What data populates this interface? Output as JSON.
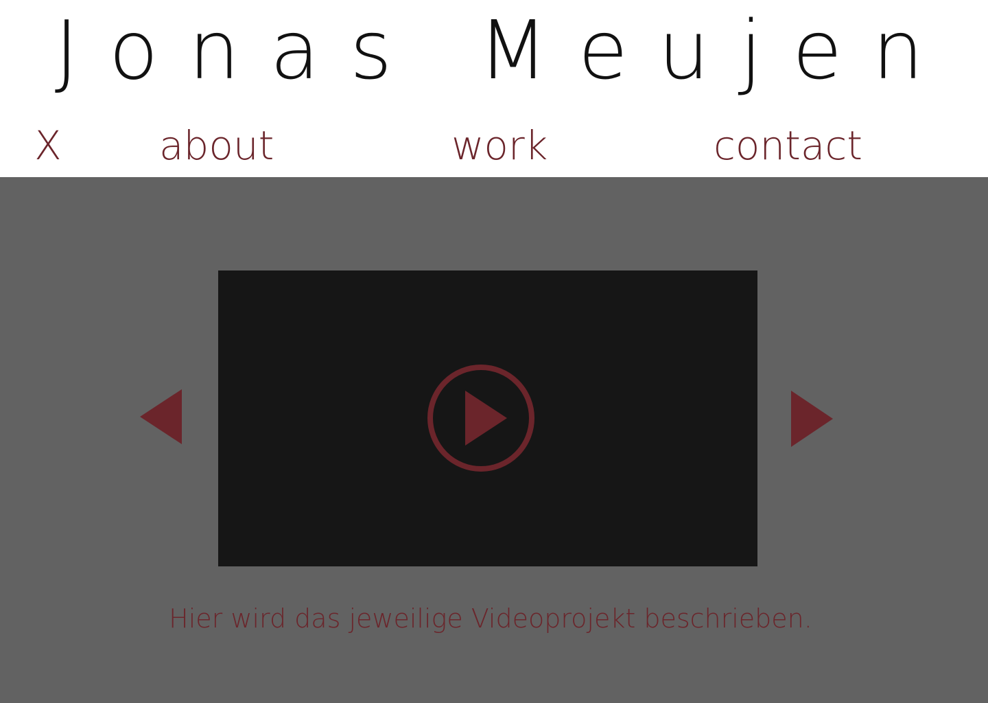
{
  "site": {
    "title": "Jonas Meujen"
  },
  "nav": {
    "close_label": "X",
    "items": [
      {
        "label": "about"
      },
      {
        "label": "work"
      },
      {
        "label": "contact"
      }
    ]
  },
  "player": {
    "play_icon": "play-icon",
    "prev_icon": "arrow-left-icon",
    "next_icon": "arrow-right-icon",
    "description": "Hier wird das jeweilige Videoprojekt beschrieben."
  },
  "colors": {
    "accent": "#6b252b",
    "stage_background": "#626262",
    "video_background": "#161616",
    "header_background": "#ffffff",
    "title_text": "#111111"
  }
}
